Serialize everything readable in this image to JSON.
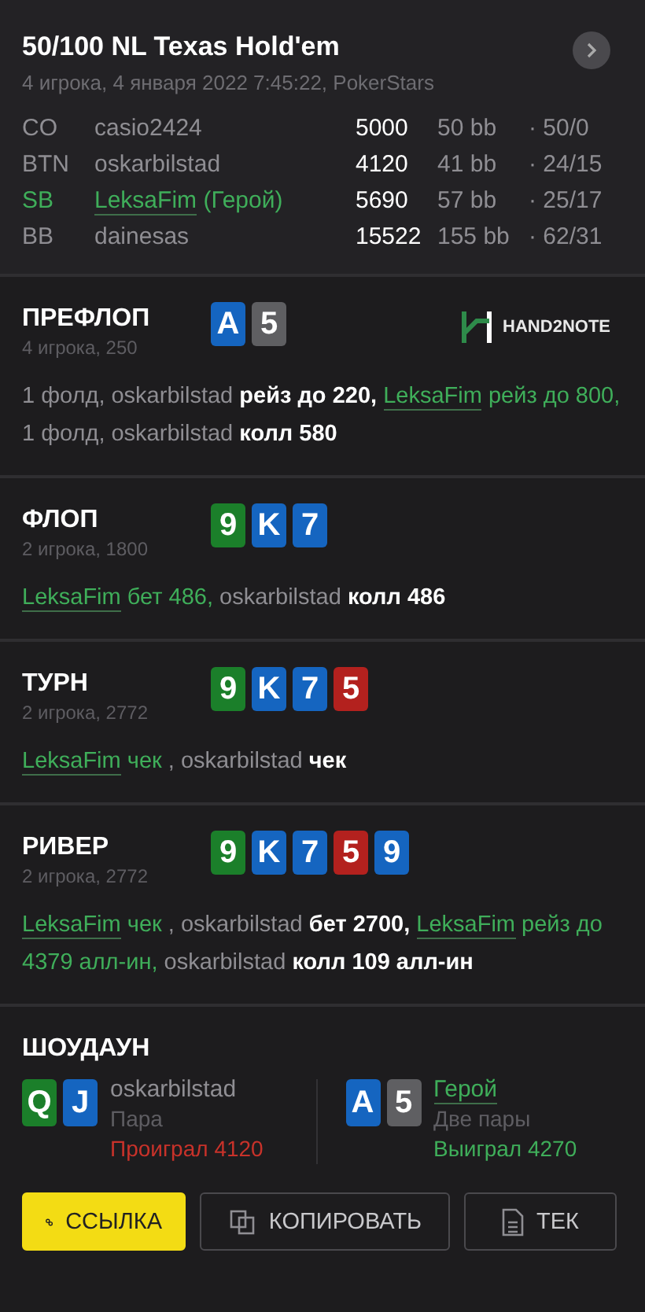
{
  "header": {
    "title": "50/100 NL Texas Hold'em",
    "subtitle": "4 игрока, 4 января 2022 7:45:22, PokerStars"
  },
  "players": [
    {
      "position": "CO",
      "name": "casio2424",
      "hero": false,
      "stack": "5000",
      "bb": "50 bb",
      "stats": "· 50/0"
    },
    {
      "position": "BTN",
      "name": "oskarbilstad",
      "hero": false,
      "stack": "4120",
      "bb": "41 bb",
      "stats": "· 24/15"
    },
    {
      "position": "SB",
      "name": "LeksaFim",
      "hero": true,
      "hero_tag": "(Герой)",
      "stack": "5690",
      "bb": "57 bb",
      "stats": "· 25/17"
    },
    {
      "position": "BB",
      "name": "dainesas",
      "hero": false,
      "stack": "15522",
      "bb": "155 bb",
      "stats": "· 62/31"
    }
  ],
  "streets": [
    {
      "title": "ПРЕФЛОП",
      "info": "4 игрока, 250",
      "logo": "HAND2NOTE",
      "cards": [
        {
          "rank": "A",
          "color": "#1565c0"
        },
        {
          "rank": "5",
          "color": "#5f5f62"
        }
      ],
      "actions": [
        {
          "kind": "muted",
          "text": "1 фолд, oskarbilstad "
        },
        {
          "kind": "action",
          "text": "рейз до 220, "
        },
        {
          "kind": "hero-name",
          "text": "LeksaFim"
        },
        {
          "kind": "hero",
          "text": " рейз до 800,"
        },
        {
          "kind": "muted",
          "text": " 1 фолд, oskarbilstad "
        },
        {
          "kind": "action",
          "text": "колл 580"
        }
      ]
    },
    {
      "title": "ФЛОП",
      "info": "2 игрока, 1800",
      "cards": [
        {
          "rank": "9",
          "color": "#1b7f2a"
        },
        {
          "rank": "K",
          "color": "#1565c0"
        },
        {
          "rank": "7",
          "color": "#1565c0"
        }
      ],
      "actions": [
        {
          "kind": "hero-name",
          "text": "LeksaFim"
        },
        {
          "kind": "hero",
          "text": " бет 486,"
        },
        {
          "kind": "muted",
          "text": " oskarbilstad "
        },
        {
          "kind": "action",
          "text": "колл 486"
        }
      ]
    },
    {
      "title": "ТУРН",
      "info": "2 игрока, 2772",
      "cards": [
        {
          "rank": "9",
          "color": "#1b7f2a"
        },
        {
          "rank": "K",
          "color": "#1565c0"
        },
        {
          "rank": "7",
          "color": "#1565c0"
        },
        {
          "rank": "5",
          "color": "#b3211e"
        }
      ],
      "actions": [
        {
          "kind": "hero-name",
          "text": "LeksaFim"
        },
        {
          "kind": "hero",
          "text": " чек "
        },
        {
          "kind": "muted",
          "text": ", oskarbilstad "
        },
        {
          "kind": "action",
          "text": "чек"
        }
      ]
    },
    {
      "title": "РИВЕР",
      "info": "2 игрока, 2772",
      "cards": [
        {
          "rank": "9",
          "color": "#1b7f2a"
        },
        {
          "rank": "K",
          "color": "#1565c0"
        },
        {
          "rank": "7",
          "color": "#1565c0"
        },
        {
          "rank": "5",
          "color": "#b3211e"
        },
        {
          "rank": "9",
          "color": "#1565c0"
        }
      ],
      "actions": [
        {
          "kind": "hero-name",
          "text": "LeksaFim"
        },
        {
          "kind": "hero",
          "text": " чек "
        },
        {
          "kind": "muted",
          "text": ", oskarbilstad "
        },
        {
          "kind": "action",
          "text": "бет 2700, "
        },
        {
          "kind": "hero-name",
          "text": "LeksaFim"
        },
        {
          "kind": "hero",
          "text": " рейз до 4379 алл-ин,"
        },
        {
          "kind": "muted",
          "text": " oskarbilstad "
        },
        {
          "kind": "action",
          "text": "колл 109 алл-ин"
        }
      ]
    }
  ],
  "showdown": {
    "title": "ШОУДАУН",
    "hands": [
      {
        "name": "oskarbilstad",
        "hero": false,
        "hand": "Пара",
        "result": "Проиграл 4120",
        "won": false,
        "cards": [
          {
            "rank": "Q",
            "color": "#1b7f2a"
          },
          {
            "rank": "J",
            "color": "#1565c0"
          }
        ]
      },
      {
        "name": "Герой",
        "hero": true,
        "hand": "Две пары",
        "result": "Выиграл 4270",
        "won": true,
        "cards": [
          {
            "rank": "A",
            "color": "#1565c0"
          },
          {
            "rank": "5",
            "color": "#5f5f62"
          }
        ]
      }
    ]
  },
  "buttons": [
    {
      "kind": "link",
      "label": "ССЫЛКА",
      "primary": true
    },
    {
      "kind": "copy",
      "label": "КОПИРОВАТЬ",
      "primary": false
    },
    {
      "kind": "text",
      "label": "ТЕК",
      "primary": false
    }
  ]
}
